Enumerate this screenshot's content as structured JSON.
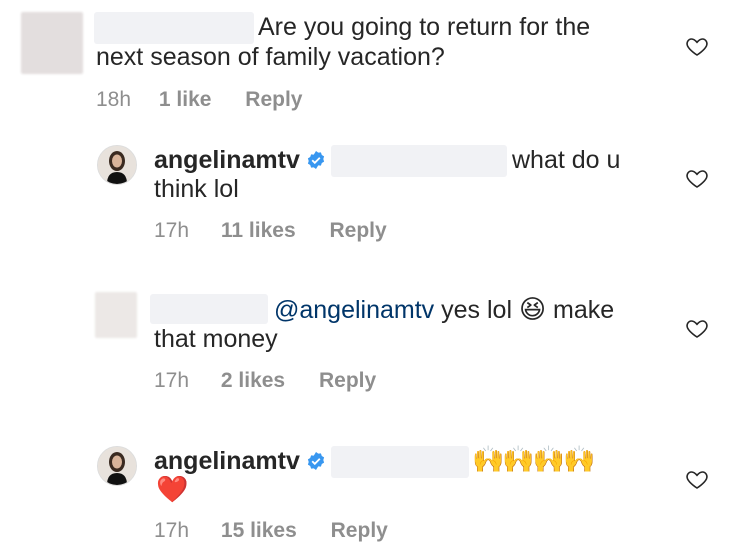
{
  "comments": [
    {
      "text_line1": "Are you going to return for the",
      "text_line2": "next season of family vacation?",
      "time": "18h",
      "likes": "1 like",
      "reply": "Reply"
    },
    {
      "username": "angelinamtv",
      "text_line1": "what do u",
      "text_line2": "think lol",
      "time": "17h",
      "likes": "11 likes",
      "reply": "Reply"
    },
    {
      "mention": "@angelinamtv",
      "text_part1": "yes lol",
      "text_part2": "make",
      "text_line2": "that money",
      "time": "17h",
      "likes": "2 likes",
      "reply": "Reply"
    },
    {
      "username": "angelinamtv",
      "emojis": "🙌🙌🙌🙌",
      "heart_emoji": "❤️",
      "time": "17h",
      "likes": "15 likes",
      "reply": "Reply"
    }
  ],
  "icons": {
    "heart": "heart-outline-icon",
    "verified": "verified-badge-icon",
    "laugh": "grinning-squinting-face-emoji"
  },
  "colors": {
    "verified": "#3897f0",
    "meta": "#8e8e8e",
    "mention": "#003569",
    "heart_red": "#e0282c"
  }
}
